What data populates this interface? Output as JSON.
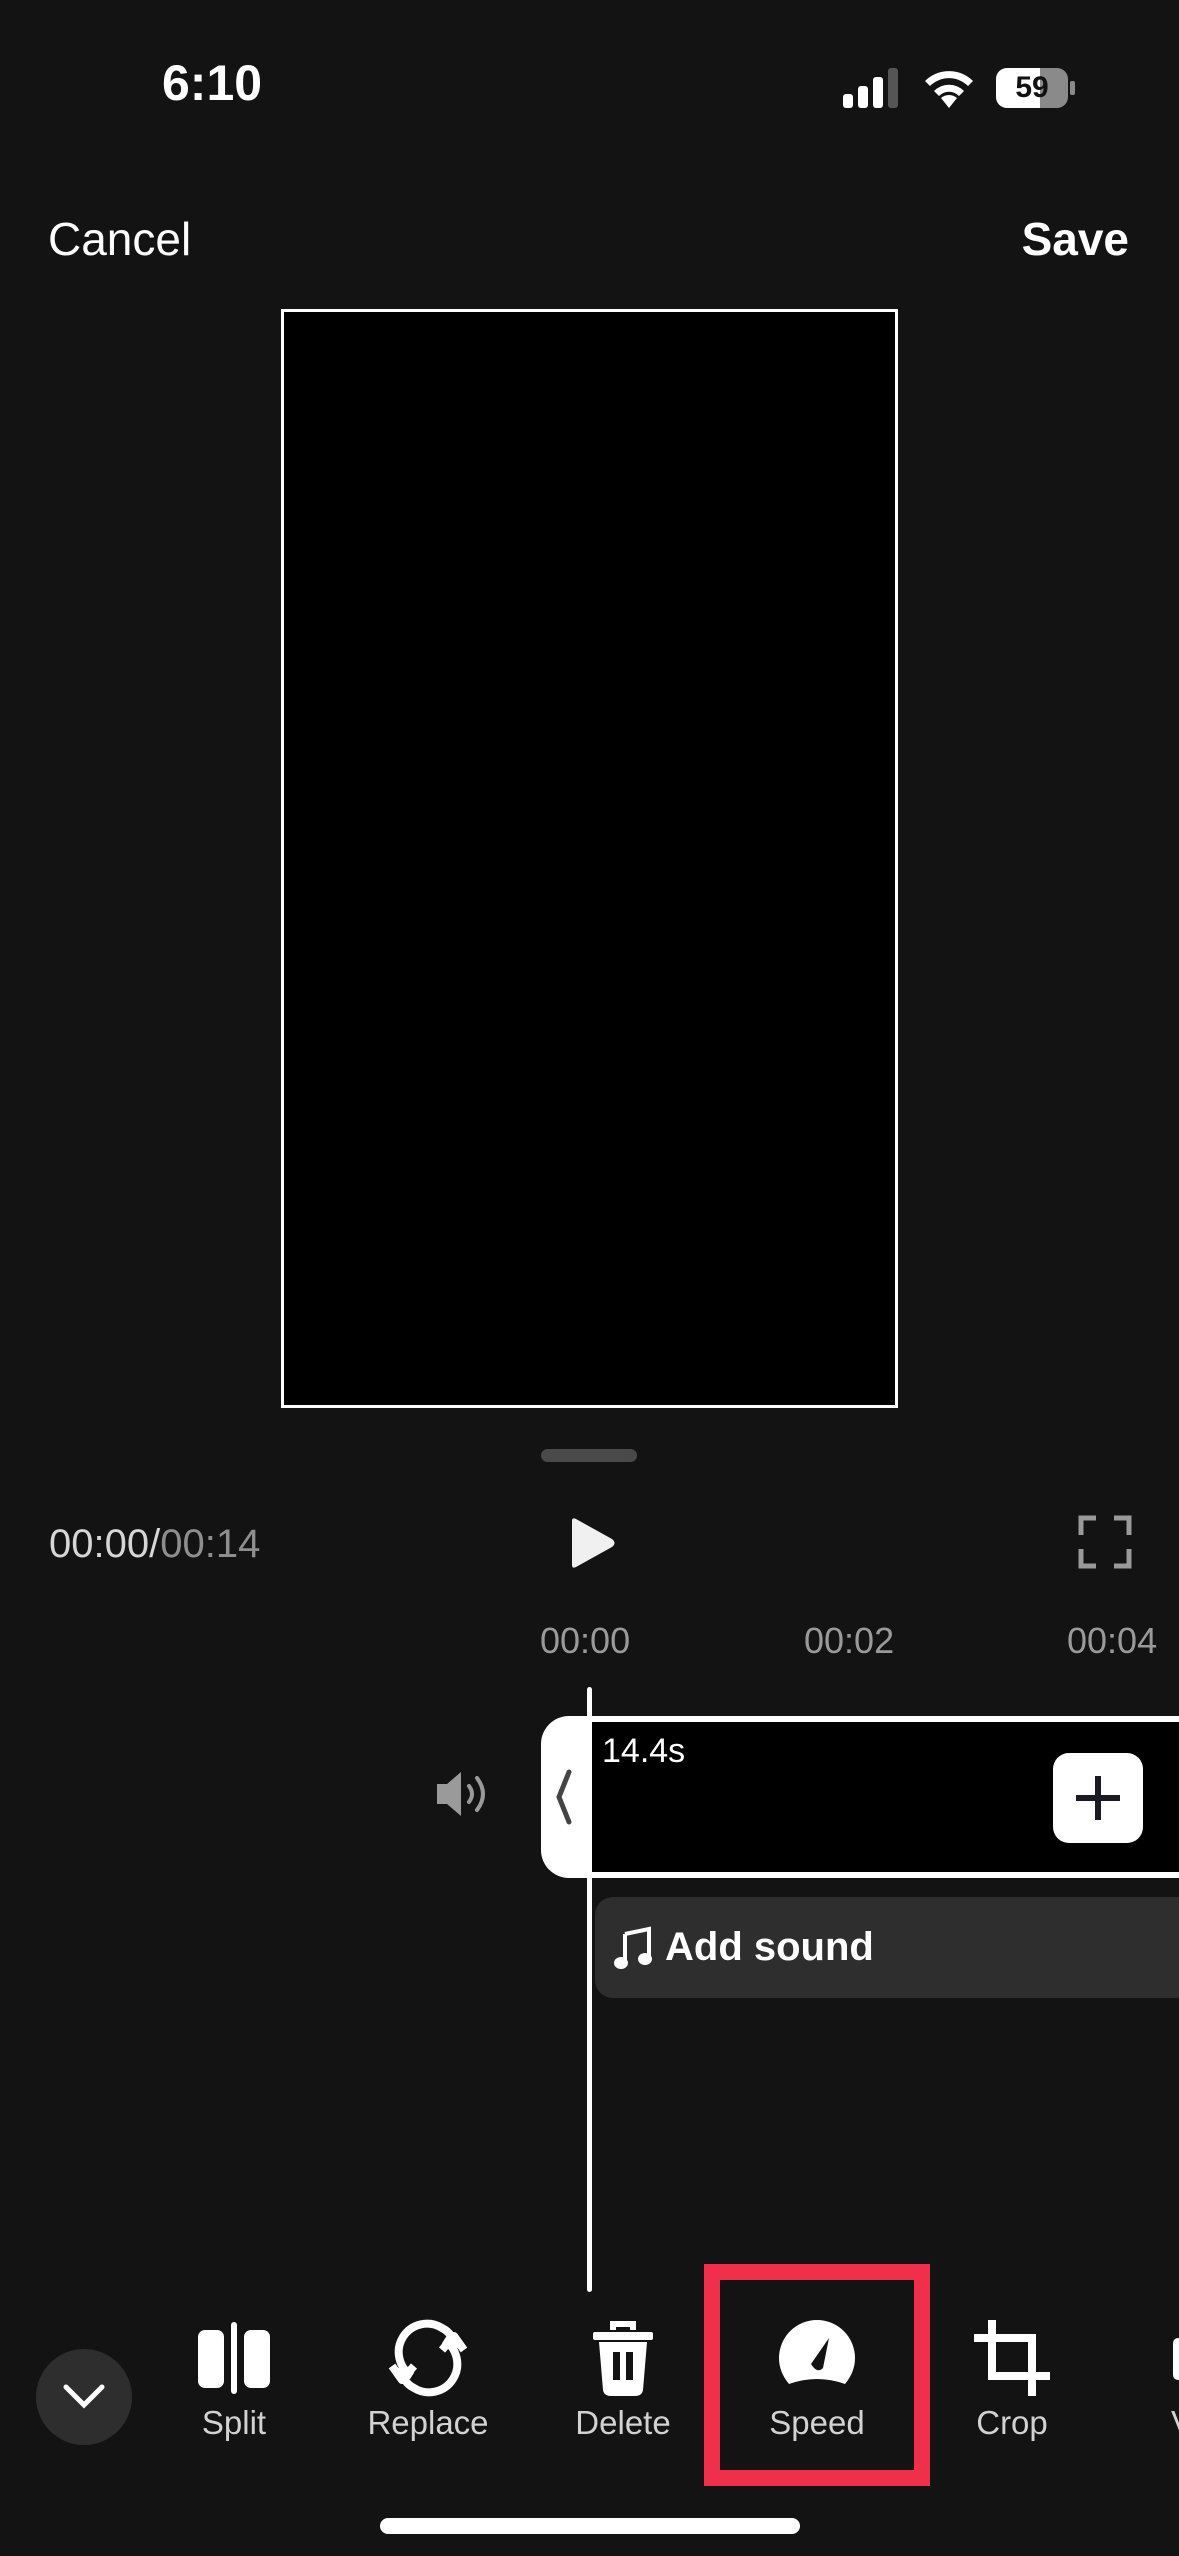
{
  "status_bar": {
    "time": "6:10",
    "battery_level": "59",
    "signal_bars_active": 3,
    "signal_bars_total": 4
  },
  "nav": {
    "cancel_label": "Cancel",
    "save_label": "Save"
  },
  "playback": {
    "current_time": "00:00",
    "separator": "/",
    "total_time": "00:14"
  },
  "ruler": {
    "ticks": [
      "00:00",
      "00:02",
      "00:04"
    ]
  },
  "clip": {
    "duration": "14.4s"
  },
  "add_sound": {
    "label": "Add sound"
  },
  "toolbar": {
    "tools": [
      {
        "id": "split",
        "label": "Split",
        "icon": "split-icon"
      },
      {
        "id": "replace",
        "label": "Replace",
        "icon": "replace-icon"
      },
      {
        "id": "delete",
        "label": "Delete",
        "icon": "trash-icon"
      },
      {
        "id": "speed",
        "label": "Speed",
        "icon": "speedometer-icon",
        "highlighted": true
      },
      {
        "id": "crop",
        "label": "Crop",
        "icon": "crop-icon"
      },
      {
        "id": "volume",
        "label": "Vo",
        "icon": "volume-icon"
      }
    ]
  },
  "colors": {
    "background": "#131313",
    "highlight": "#f0304a",
    "sound_track": "#2e2e2e"
  }
}
